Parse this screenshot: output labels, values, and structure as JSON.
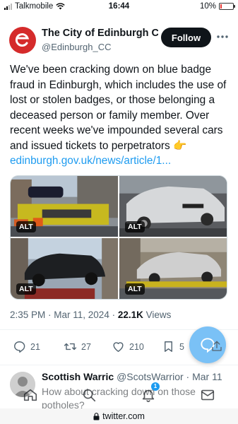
{
  "status_bar": {
    "carrier": "Talkmobile",
    "time": "16:44",
    "battery": "10%"
  },
  "tweet": {
    "display_name": "The City of Edinburgh Cou",
    "handle": "@Edinburgh_CC",
    "follow_label": "Follow",
    "text": "We've been cracking down on blue badge fraud in Edinburgh, which includes the use of lost or stolen badges, or those belonging a deceased person or family member. Over recent weeks we've impounded several cars and issued tickets to perpetrators 👉",
    "link": "edinburgh.gov.uk/news/article/1...",
    "alt_label": "ALT",
    "date": "2:35 PM · Mar 11, 2024 · ",
    "views_count": "22.1K",
    "views_label": " Views",
    "replies": "21",
    "retweets": "27",
    "likes": "210",
    "bookmarks": "5"
  },
  "reply": {
    "name": "Scottish Warric",
    "handle_date": "@ScotsWarrior · Mar 11",
    "text": "How about cracking down on those potholes?"
  },
  "tabbar": {
    "notification_count": "1"
  },
  "url_bar": {
    "url": "twitter.com"
  },
  "colors": {
    "accent": "#1d9bf0",
    "brand_red": "#d52b2b",
    "text": "#0f1419",
    "muted": "#536471"
  }
}
